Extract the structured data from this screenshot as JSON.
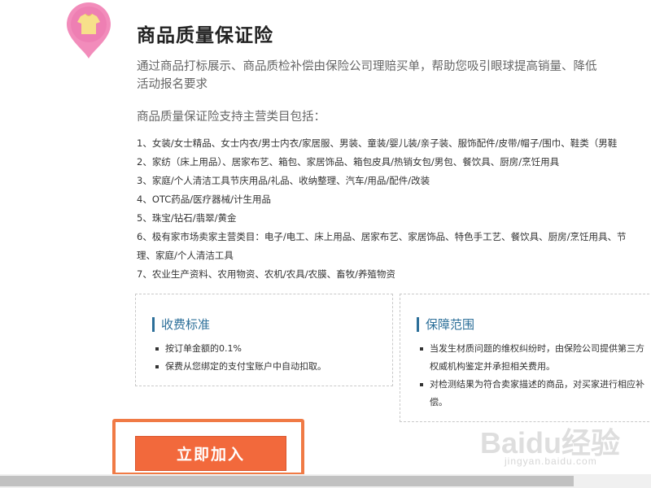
{
  "header": {
    "title": "商品质量保证险",
    "intro_line1": "通过商品打标展示、商品质检补偿由保险公司理赔买单，帮助您吸引眼球提高销量、降低",
    "intro_line2": "活动报名要求"
  },
  "categories": {
    "heading": "商品质量保证险支持主营类目包括：",
    "items": [
      "1、女装/女士精品、女士内衣/男士内衣/家居服、男装、童装/婴儿装/亲子装、服饰配件/皮带/帽子/围巾、鞋类（男鞋",
      "2、家纺（床上用品）、居家布艺、箱包、家居饰品、箱包皮具/热销女包/男包、餐饮具、厨房/烹饪用具",
      "3、家庭/个人清洁工具节庆用品/礼品、收纳整理、汽车/用品/配件/改装",
      "4、OTC药品/医疗器械/计生用品",
      "5、珠宝/钻石/翡翠/黄金",
      "6、极有家市场卖家主营类目：电子/电工、床上用品、居家布艺、家居饰品、特色手工艺、餐饮具、厨房/烹饪用具、节",
      "理、家庭/个人清洁工具",
      "7、农业生产资料、农用物资、农机/农具/农膜、畜牧/养殖物资"
    ]
  },
  "fee_box": {
    "title": "收费标准",
    "items": [
      "按订单金额的0.1%",
      "保费从您绑定的支付宝账户中自动扣取。"
    ]
  },
  "scope_box": {
    "title": "保障范围",
    "items": [
      "当发生材质问题的维权纠纷时，由保险公司提供第三方权威机构鉴定并承担相关费用。",
      "对检测结果为符合卖家描述的商品，对买家进行相应补偿。"
    ]
  },
  "join_button_label": "立即加入",
  "watermark": {
    "logo": "Baidu经验",
    "url": "jingyan.baidu.com"
  },
  "icons": {
    "pin": "tshirt-pin-icon"
  },
  "colors": {
    "accent": "#f2693c",
    "highlight": "#f07a45",
    "box_title": "#2c6f99",
    "pin": "#f07ab0"
  }
}
